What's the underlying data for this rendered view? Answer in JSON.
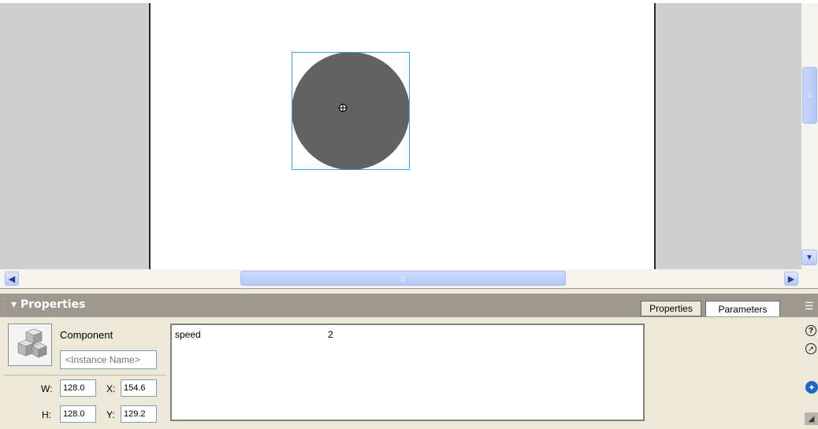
{
  "panel": {
    "title": "Properties",
    "tabs": [
      {
        "label": "Properties"
      },
      {
        "label": "Parameters"
      }
    ]
  },
  "component": {
    "type_label": "Component",
    "instance_name_placeholder": "<Instance Name>",
    "w_label": "W:",
    "w_value": "128.0",
    "h_label": "H:",
    "h_value": "128.0",
    "x_label": "X:",
    "x_value": "154.6",
    "y_label": "Y:",
    "y_value": "129.2"
  },
  "parameters": [
    {
      "name": "speed",
      "value": "2"
    }
  ],
  "icons": {
    "panel_options": "panel-options-icon",
    "help": "help-icon",
    "edit": "edit-icon",
    "accessibility": "accessibility-icon",
    "component_symbol": "component-symbol-icon"
  },
  "colors": {
    "selection": "#3aa3e3",
    "component_fill": "#626262",
    "panel_header": "#9d998e"
  }
}
